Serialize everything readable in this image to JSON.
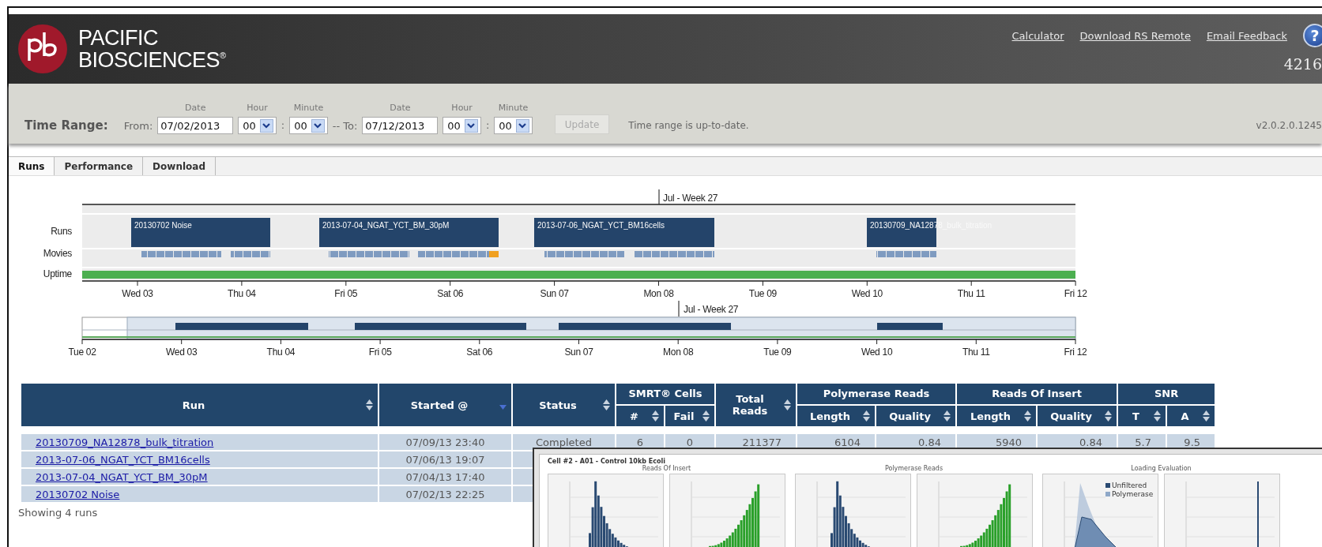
{
  "header": {
    "brand": [
      "PACIFIC",
      "BIOSCIENCES"
    ],
    "registered": "®",
    "links": [
      "Calculator",
      "Download RS Remote",
      "Email Feedback"
    ],
    "help": "?",
    "count": "4216"
  },
  "time_range": {
    "label": "Time Range:",
    "from_label": "From:",
    "to_label": "-- To:",
    "from": {
      "date_caption": "Date",
      "hour_caption": "Hour",
      "minute_caption": "Minute",
      "date": "07/02/2013",
      "hour": "00",
      "separator": ":",
      "minute": "00"
    },
    "to": {
      "date_caption": "Date",
      "hour_caption": "Hour",
      "minute_caption": "Minute",
      "date": "07/12/2013",
      "hour": "00",
      "separator": ":",
      "minute": "00"
    },
    "update_button": {
      "label": "Update",
      "disabled": true
    },
    "status": "Time range is up-to-date.",
    "version": "v2.0.2.0.1245"
  },
  "tabs": [
    {
      "label": "Runs",
      "selected": true
    },
    {
      "label": "Performance",
      "selected": false
    },
    {
      "label": "Download",
      "selected": false
    }
  ],
  "timeline": {
    "week_label": "Jul - Week 27",
    "lanes": [
      "Runs",
      "Movies",
      "Uptime"
    ],
    "runs": [
      {
        "label": "20130702 Noise"
      },
      {
        "label": "2013-07-04_NGAT_YCT_BM_30pM"
      },
      {
        "label": "2013-07-06_NGAT_YCT_BM16cells"
      },
      {
        "label": "20130709_NA12878_bulk_titration"
      }
    ],
    "day_ticks": [
      "Wed 03",
      "Thu 04",
      "Fri 05",
      "Sat 06",
      "Sun 07",
      "Mon 08",
      "Tue 09",
      "Wed 10",
      "Thu 11",
      "Fri 12"
    ],
    "overview": {
      "week_label": "Jul - Week 27",
      "day_ticks": [
        "Tue 02",
        "Wed 03",
        "Thu 04",
        "Fri 05",
        "Sat 06",
        "Sun 07",
        "Mon 08",
        "Tue 09",
        "Wed 10",
        "Thu 11",
        "Fri 12"
      ]
    }
  },
  "table": {
    "header_cells": [
      {
        "label": "Run",
        "sorted": false
      },
      {
        "label": "Started @",
        "sorted": true
      },
      {
        "label": "Status",
        "sorted": false
      },
      {
        "label": "SMRT® Cells",
        "children": [
          {
            "label": "#",
            "sorted": false
          },
          {
            "label": "Fail",
            "sorted": false
          }
        ]
      },
      {
        "label": "Total Reads",
        "sorted": false
      },
      {
        "label": "Polymerase Reads",
        "children": [
          {
            "label": "Length",
            "sorted": false
          },
          {
            "label": "Quality",
            "sorted": false
          }
        ]
      },
      {
        "label": "Reads Of Insert",
        "children": [
          {
            "label": "Length",
            "sorted": false
          },
          {
            "label": "Quality",
            "sorted": false
          }
        ]
      },
      {
        "label": "SNR",
        "children": [
          {
            "label": "T",
            "sorted": false
          },
          {
            "label": "A",
            "sorted": false
          }
        ]
      }
    ],
    "rows": [
      [
        "20130709_NA12878_bulk_titration",
        "07/09/13 23:40",
        "Completed",
        "6",
        "0",
        "211377",
        "6104",
        "0.84",
        "5940",
        "0.84",
        "5.7",
        "9.5"
      ],
      [
        "2013-07-06_NGAT_YCT_BM16cells",
        "07/06/13 19:07"
      ],
      [
        "2013-07-04_NGAT_YCT_BM_30pM",
        "07/04/13 17:40"
      ],
      [
        "20130702 Noise",
        "07/02/13 22:25"
      ]
    ],
    "footer": "Showing 4 runs"
  },
  "cell_window": {
    "title": "Cell #2 - A01 - Control 10kb Ecoli",
    "sections": [
      "Reads Of Insert",
      "Polymerase Reads",
      "Loading Evaluation"
    ],
    "legend": [
      "Unfiltered",
      "Polymerase"
    ]
  }
}
